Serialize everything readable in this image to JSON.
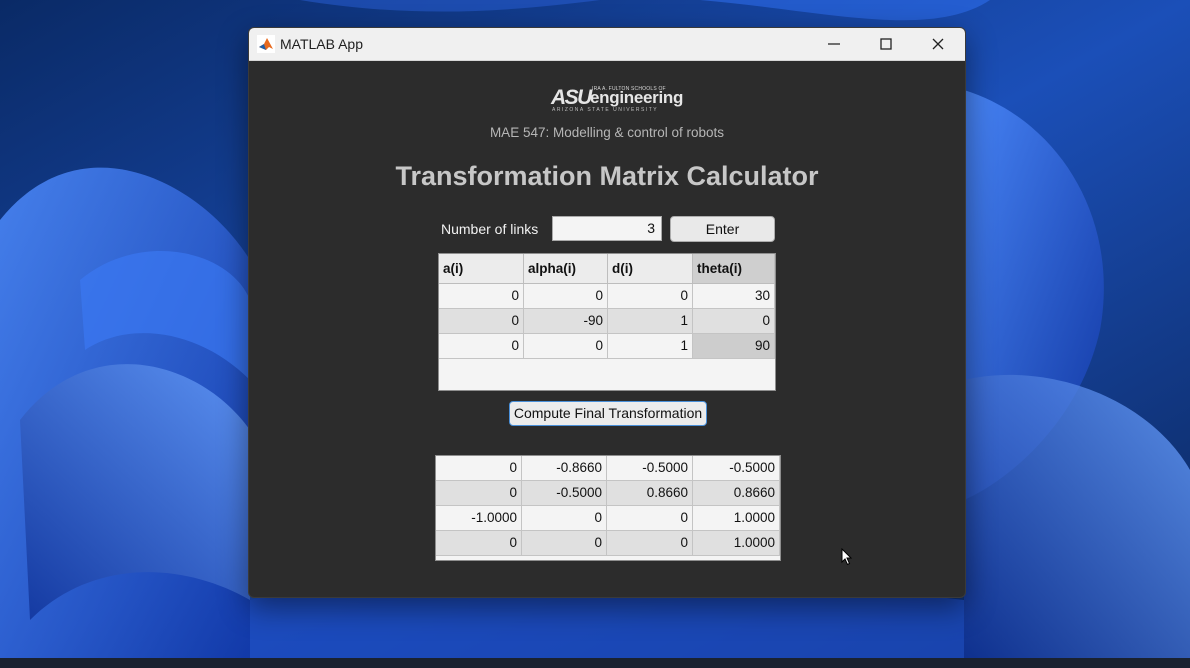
{
  "window": {
    "title": "MATLAB App",
    "icons": {
      "app": "matlab-logo-icon",
      "minimize": "minimize-icon",
      "maximize": "maximize-icon",
      "close": "close-icon"
    }
  },
  "logo": {
    "small_text": "IRA A. FULTON SCHOOLS OF",
    "asu": "ASU",
    "engineering": "engineering",
    "university": "ARIZONA STATE UNIVERSITY"
  },
  "course": "MAE 547: Modelling & control of robots",
  "heading": "Transformation Matrix Calculator",
  "links": {
    "label": "Number of links",
    "value": "3",
    "enter_label": "Enter"
  },
  "dh_table": {
    "headers": [
      "a(i)",
      "alpha(i)",
      "d(i)",
      "theta(i)"
    ],
    "rows": [
      [
        "0",
        "0",
        "0",
        "30"
      ],
      [
        "0",
        "-90",
        "1",
        "0"
      ],
      [
        "0",
        "0",
        "1",
        "90"
      ]
    ]
  },
  "compute_label": "Compute Final Transformation",
  "result_matrix": {
    "rows": [
      [
        "0",
        "-0.8660",
        "-0.5000",
        "-0.5000"
      ],
      [
        "0",
        "-0.5000",
        "0.8660",
        "0.8660"
      ],
      [
        "-1.0000",
        "0",
        "0",
        "1.0000"
      ],
      [
        "0",
        "0",
        "0",
        "1.0000"
      ]
    ]
  },
  "colors": {
    "window_bg": "#2c2c2c",
    "titlebar_bg": "#f0f0f0",
    "accent_border": "#4a90d9",
    "wallpaper_base": "#0b2f73"
  }
}
